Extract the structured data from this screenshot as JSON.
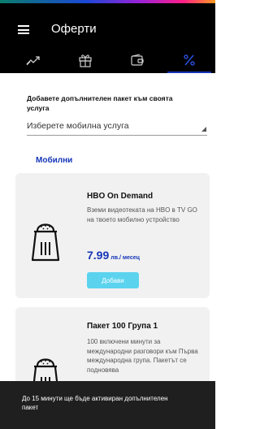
{
  "header": {
    "title": "Оферти",
    "menu_icon": "hamburger-menu-icon"
  },
  "tabs": [
    {
      "icon": "trending-icon",
      "active": false
    },
    {
      "icon": "gift-icon",
      "active": false
    },
    {
      "icon": "wallet-icon",
      "active": false
    },
    {
      "icon": "percent-icon",
      "active": true
    }
  ],
  "colors": {
    "accent": "#1536b8",
    "button": "#5bd3ee",
    "card_bg": "#f1f1f1",
    "topbar": "#000000"
  },
  "section": {
    "title": "Добавете допълнителен пакет към своята услуга",
    "select_value": "Изберете мобилна услуга"
  },
  "category_label": "Мобилни",
  "offers": [
    {
      "icon": "salt-shaker-icon",
      "title": "HBO On Demand",
      "description": "Вземи видеотеката на HBO в TV GO на твоето мобилно устройство",
      "price": "7.99",
      "price_unit": "лв./ месец",
      "button_label": "Добави"
    },
    {
      "icon": "salt-shaker-icon",
      "title": "Пакет 100 Група 1",
      "description": "100 включени минути за международни разговори към Първа международна група. Пакетът се подновява"
    }
  ],
  "toast": {
    "text": "До 15 минути ще бъде активиран допълнителен пакет"
  }
}
